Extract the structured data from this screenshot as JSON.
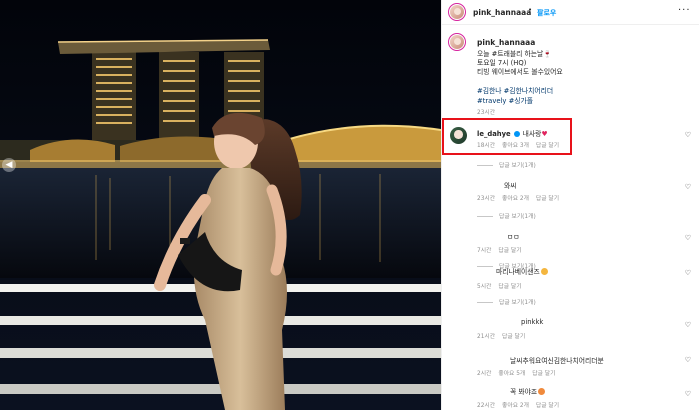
{
  "post": {
    "username": "pink_hannaaa",
    "follow_label": "팔로우",
    "menu_icon": "more-dots-icon"
  },
  "caption": {
    "username": "pink_hannaaa",
    "lines": [
      "오늘 #트래블리 하는날🍷",
      "토요일 7시 (HQ)",
      "티빙 웨이브에서도 볼수있어요"
    ],
    "tags": "#김한나 #김한나치어리더",
    "tags2": "#travely #싱가폴",
    "time": "23시간"
  },
  "comments": [
    {
      "username": "le_dahye",
      "text": "내사랑",
      "time": "18시간",
      "likes": "좋아요 3개",
      "reply": "답글 달기",
      "replies": "답글 보기(1개)"
    },
    {
      "username": "",
      "text": "와씨",
      "time": "23시간",
      "likes": "좋아요 2개",
      "reply": "답글 달기",
      "replies": "답글 보기(1개)"
    },
    {
      "username": "",
      "text": "ㅁㅁ",
      "time": "7시간",
      "likes": "",
      "reply": "답글 달기",
      "replies": "답글 보기(1개)"
    },
    {
      "username": "",
      "text": "마리나베이샌즈",
      "time": "5시간",
      "likes": "",
      "reply": "답글 달기",
      "replies": "답글 보기(1개)"
    },
    {
      "username": "",
      "text": "pinkkk",
      "time": "21시간",
      "likes": "",
      "reply": "답글 달기",
      "replies": ""
    },
    {
      "username": "",
      "text": "날씨추워요여신김한나치어리더분",
      "time": "2시간",
      "likes": "좋아요 5개",
      "reply": "답글 달기",
      "replies": ""
    },
    {
      "username": "",
      "text": "꼭 봐야죠",
      "time": "22시간",
      "likes": "좋아요 2개",
      "reply": "답글 달기",
      "replies": ""
    }
  ],
  "colors": {
    "accent": "#0095f6",
    "highlight": "#e8121a",
    "muted": "#8e8e8e"
  }
}
